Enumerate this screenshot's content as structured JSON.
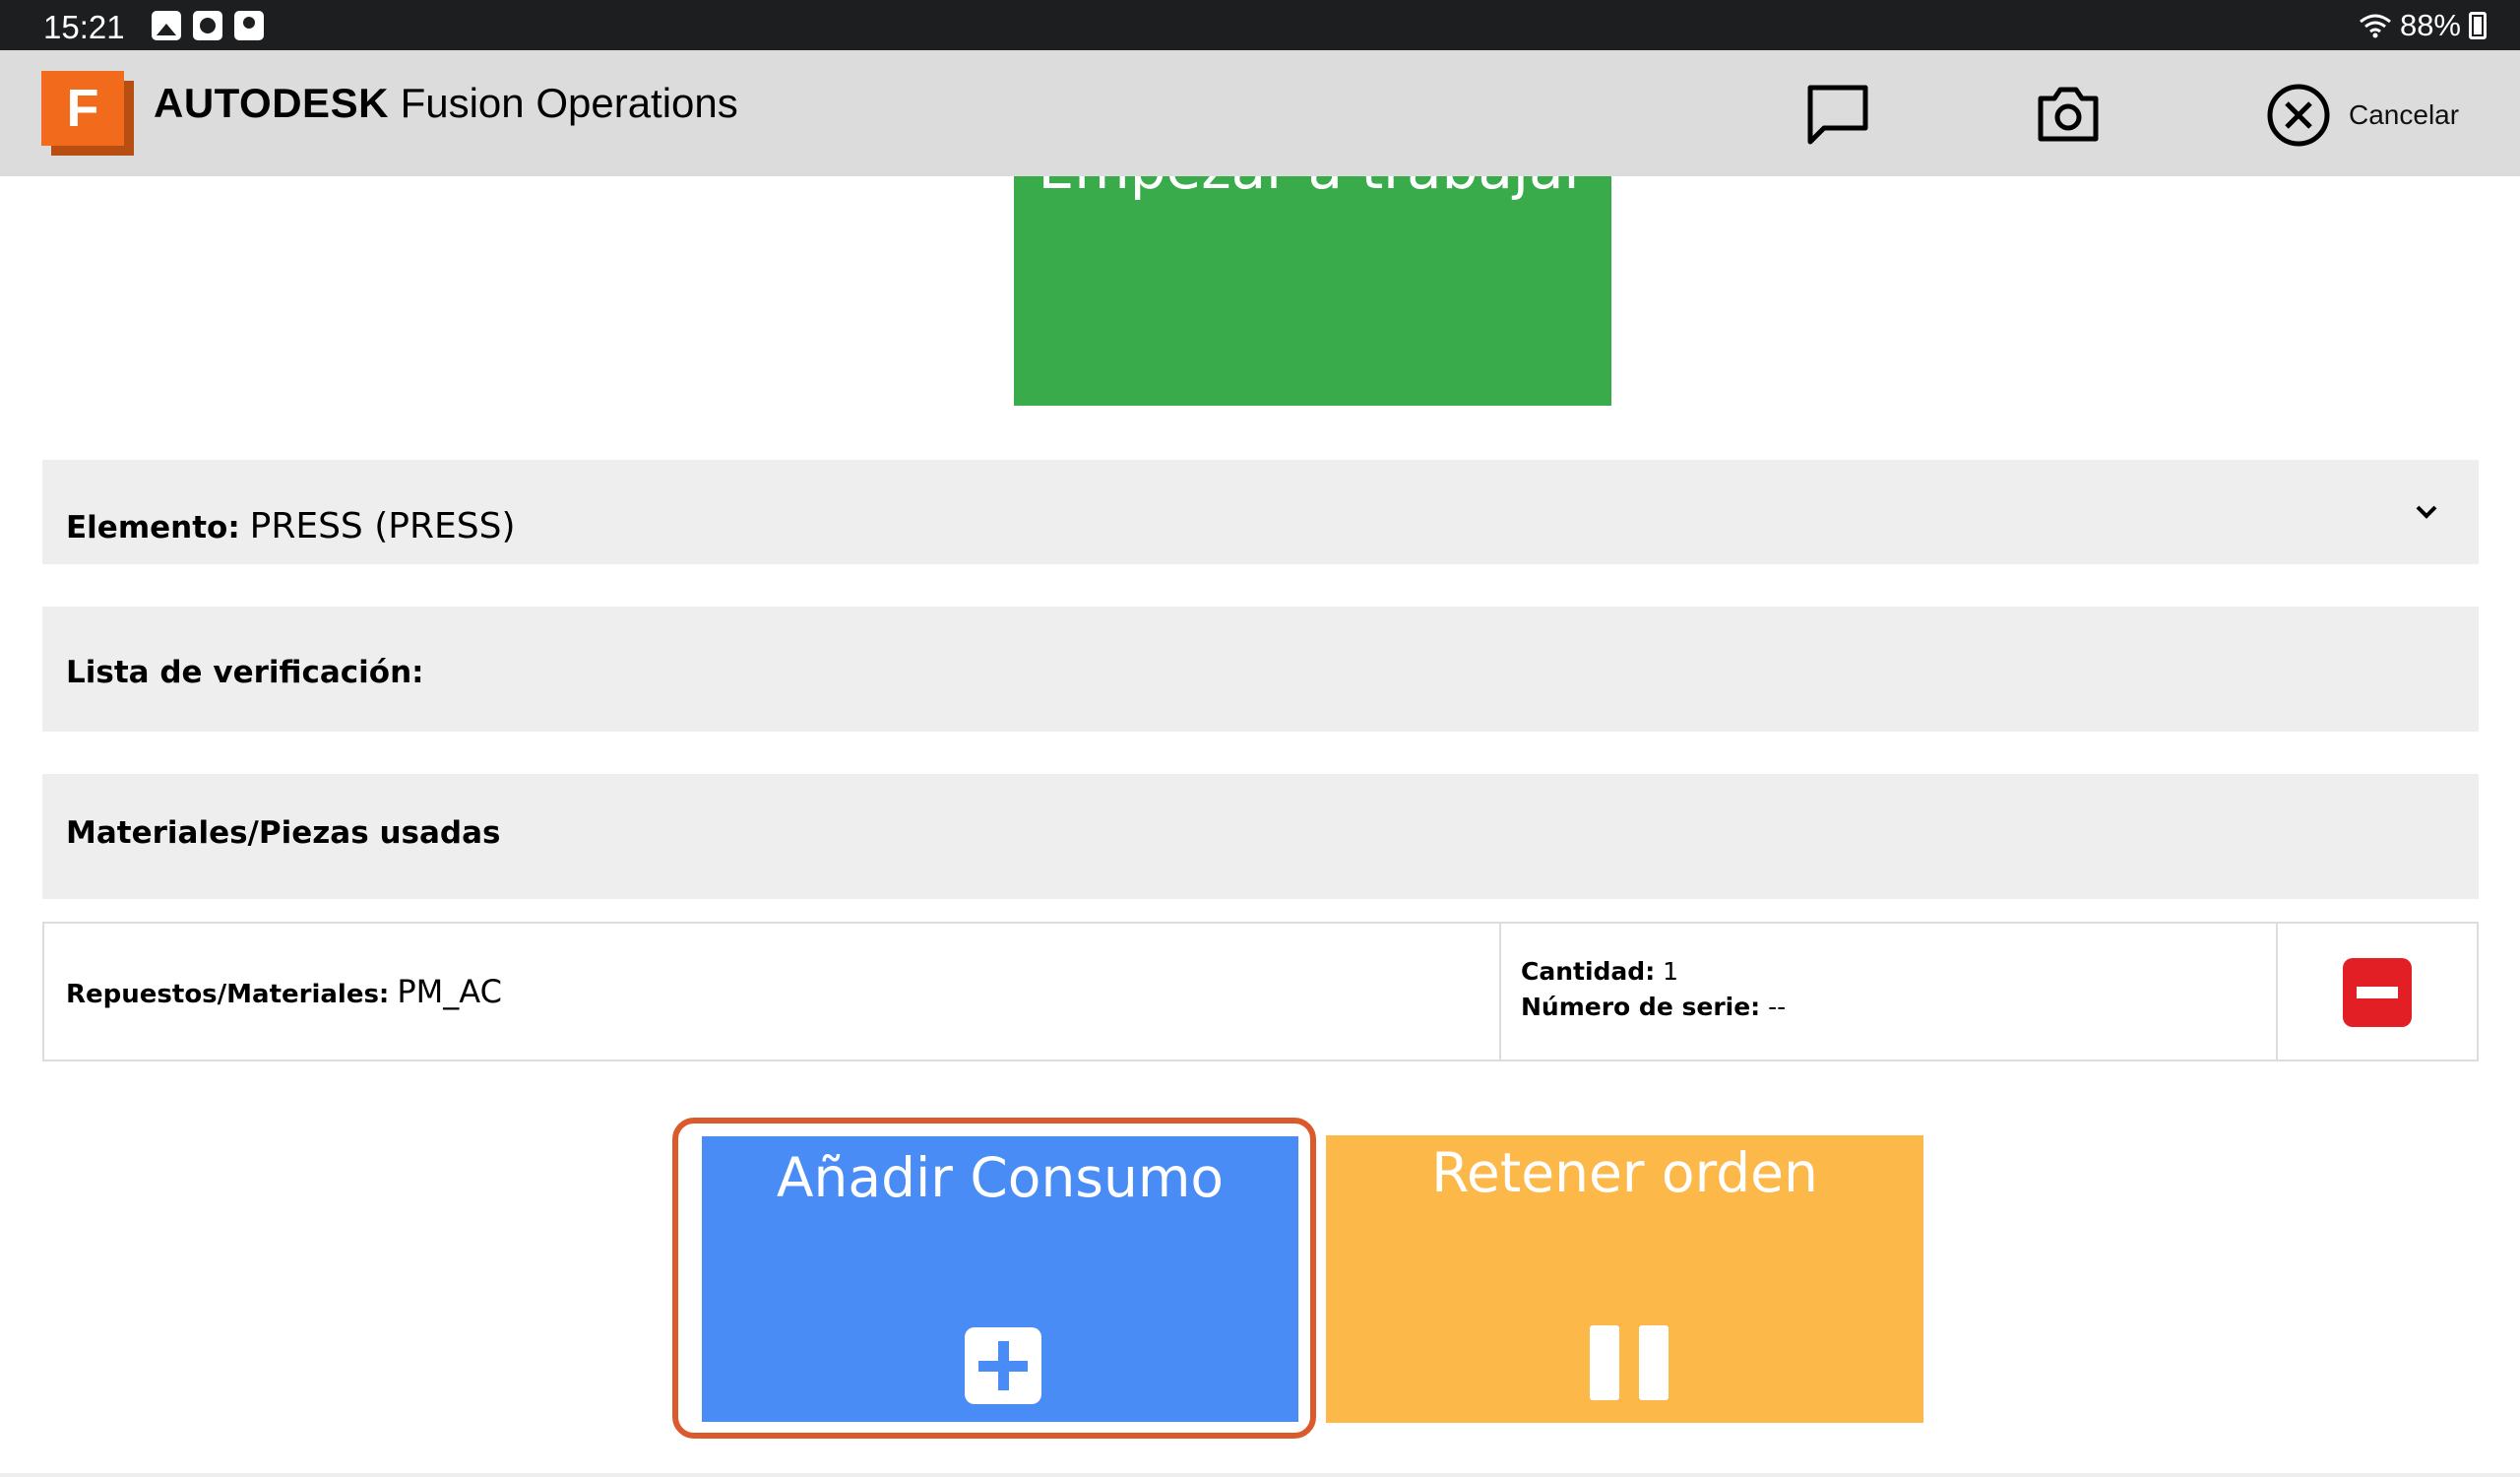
{
  "status_bar": {
    "time": "15:21",
    "battery": "88%",
    "icons": [
      "gallery-icon",
      "clock-app-icon",
      "person-app-icon",
      "wifi-icon",
      "battery-charging-icon"
    ]
  },
  "header": {
    "brand_bold": "AUTODESK",
    "brand_rest": " Fusion Operations",
    "logo_letter": "F",
    "cancel_label": "Cancelar",
    "icons": [
      "comment-icon",
      "camera-icon",
      "close-circle-icon"
    ]
  },
  "start_work": {
    "label": "Empezar a trabajar"
  },
  "element_panel": {
    "label": "Elemento:",
    "value": "PRESS (PRESS)"
  },
  "checklist_panel": {
    "label": "Lista de verificación:"
  },
  "materials_panel": {
    "label": "Materiales/Piezas usadas"
  },
  "material_row": {
    "parts_label": "Repuestos/Materiales:",
    "parts_value": "PM_AC",
    "qty_label": "Cantidad:",
    "qty_value": "1",
    "serial_label": "Número de serie:",
    "serial_value": "--"
  },
  "actions": {
    "add_label": "Añadir Consumo",
    "hold_label": "Retener orden"
  },
  "colors": {
    "start_green": "#39ab4a",
    "add_blue": "#4a8cf5",
    "hold_orange": "#fdb84a",
    "highlight": "#db5a2c",
    "remove_red": "#e21f25",
    "logo_orange": "#f26b1d"
  }
}
